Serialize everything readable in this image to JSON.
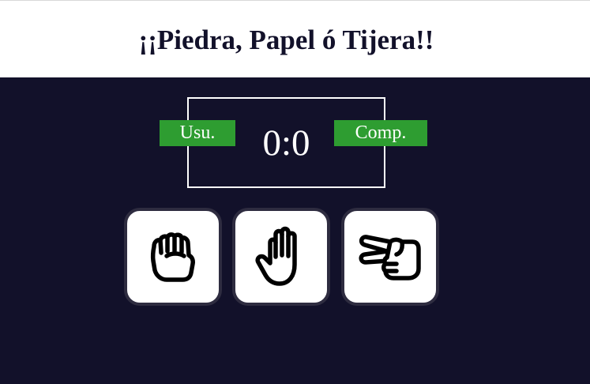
{
  "title": "¡¡Piedra, Papel ó Tijera!!",
  "scoreboard": {
    "user_label": "Usu.",
    "computer_label": "Comp.",
    "score": "0:0"
  },
  "choices": [
    {
      "id": "piedra",
      "icon": "fist-rock-icon"
    },
    {
      "id": "papel",
      "icon": "open-hand-paper-icon"
    },
    {
      "id": "tijera",
      "icon": "scissors-hand-icon"
    }
  ],
  "colors": {
    "background": "#12112a",
    "header": "#ffffff",
    "badge": "#2e9d31",
    "button_border": "#2e2c40"
  }
}
